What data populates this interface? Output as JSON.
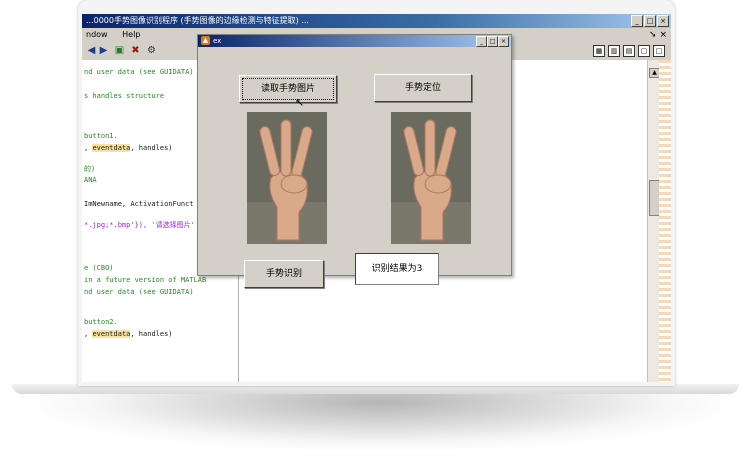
{
  "window": {
    "title": "...0000手势图像识别程序 (手势图像的边缘检测与特征提取) ...",
    "menu": [
      "ndow",
      "Help"
    ],
    "controls": [
      "_",
      "□",
      "×"
    ]
  },
  "editor": {
    "lines": [
      {
        "t": "nd user data (see GUIDATA)",
        "cls": "c"
      },
      {
        "t": "s handles structure",
        "cls": "c"
      },
      {
        "t": "button1.",
        "cls": "c"
      },
      {
        "t": ", eventdata, handles)",
        "cls": "k",
        "hl": "eventdata"
      },
      {
        "t": "的)",
        "cls": "c"
      },
      {
        "t": "ANA",
        "cls": "c"
      },
      {
        "t": "ImNewname, ActivationFunct",
        "cls": "k"
      },
      {
        "t": "*.jpg;*.bmp'}), '请选择图片'",
        "cls": "m"
      },
      {
        "t": "e (CBO)",
        "cls": "c"
      },
      {
        "t": "in a future version of MATLAB",
        "cls": "c"
      },
      {
        "t": "nd user data (see GUIDATA)",
        "cls": "c"
      },
      {
        "t": "button2.",
        "cls": "c"
      },
      {
        "t": ", eventdata, handles)",
        "cls": "k",
        "hl": "eventdata"
      }
    ]
  },
  "dialog": {
    "title": "ex",
    "btn_load": "读取手势图片",
    "btn_locate": "手势定位",
    "btn_recognize": "手势识别",
    "result": "识别结果为3"
  },
  "icons": {
    "toolbar": [
      "arrow-back-icon",
      "arrow-forward-icon",
      "run-icon",
      "stop-icon",
      "debug-icon"
    ],
    "layout": [
      "tile-icon",
      "split-icon",
      "stack-icon",
      "float-icon",
      "maximize-icon"
    ]
  },
  "colors": {
    "accent": "#0a246a",
    "face": "#d4d0c8"
  }
}
